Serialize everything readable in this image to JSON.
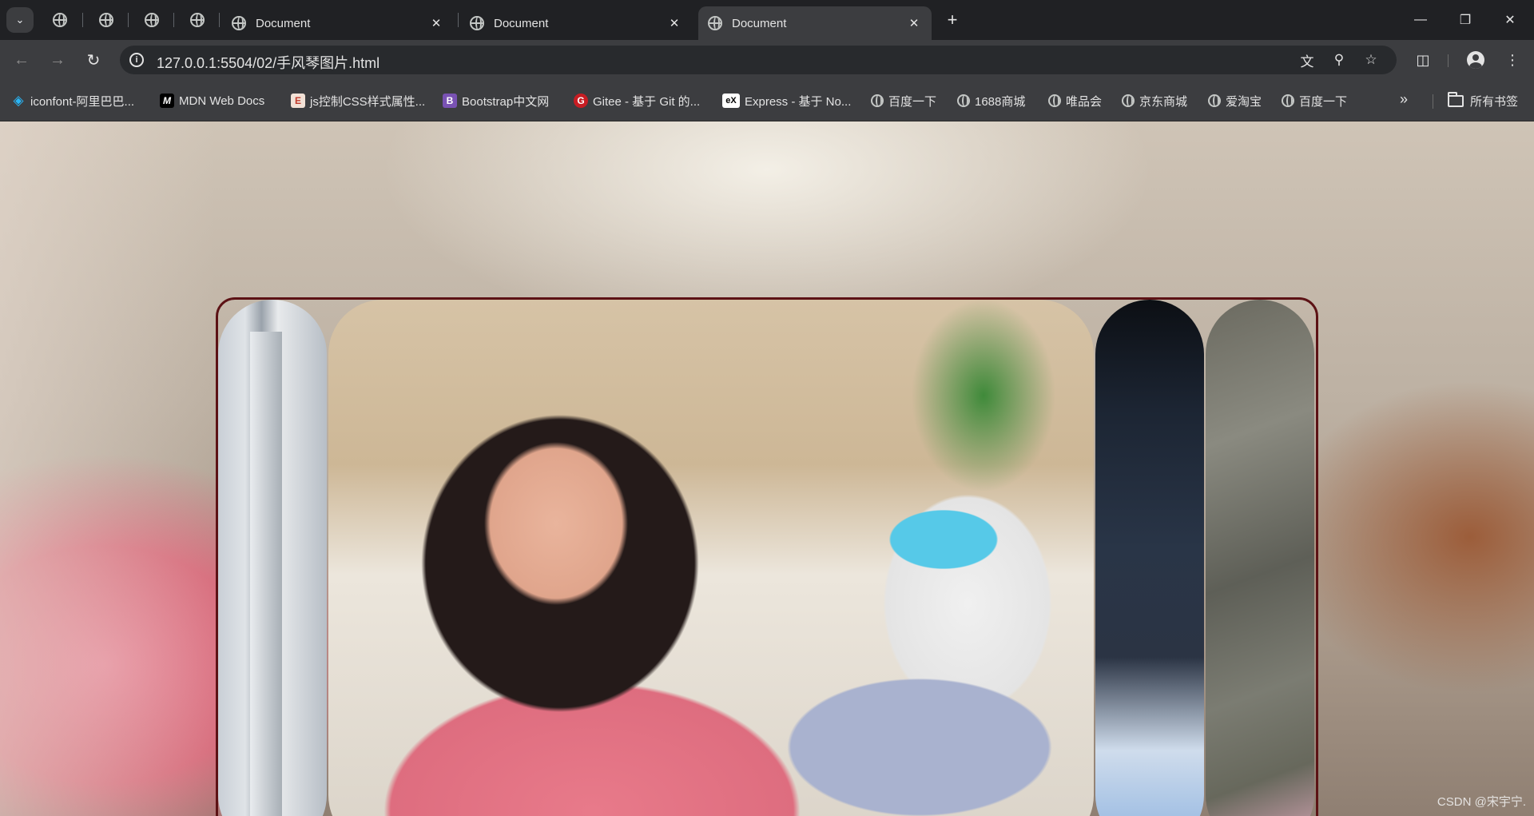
{
  "tabs": [
    {
      "title": "Document",
      "active": false
    },
    {
      "title": "Document",
      "active": false
    },
    {
      "title": "Document",
      "active": true
    }
  ],
  "toolbar": {
    "url": "127.0.0.1:5504/02/手风琴图片.html"
  },
  "bookmarks": [
    {
      "label": "iconfont-阿里巴巴...",
      "icon": "iconfont-icon",
      "color": "#29b6f6"
    },
    {
      "label": "MDN Web Docs",
      "icon": "mdn-icon",
      "color": "#000000"
    },
    {
      "label": "js控制CSS样式属性...",
      "icon": "csdn-icon",
      "color": "#c0392b"
    },
    {
      "label": "Bootstrap中文网",
      "icon": "bootstrap-icon",
      "color": "#7952b3"
    },
    {
      "label": "Gitee - 基于 Git 的...",
      "icon": "gitee-icon",
      "color": "#c71d23"
    },
    {
      "label": "Express - 基于 No...",
      "icon": "express-icon",
      "color": "#ffffff"
    },
    {
      "label": "百度一下",
      "icon": "globe-icon"
    },
    {
      "label": "1688商城",
      "icon": "globe-icon"
    },
    {
      "label": "唯品会",
      "icon": "globe-icon"
    },
    {
      "label": "京东商城",
      "icon": "globe-icon"
    },
    {
      "label": "爱淘宝",
      "icon": "globe-icon"
    },
    {
      "label": "百度一下",
      "icon": "globe-icon"
    }
  ],
  "all_bookmarks_label": "所有书签",
  "page": {
    "gallery": {
      "border_color": "#5c1215",
      "expanded_index": 1,
      "photos": [
        {
          "name": "photo-1-stairs"
        },
        {
          "name": "photo-2-girl-salute"
        },
        {
          "name": "photo-3-dark"
        },
        {
          "name": "photo-4-grass"
        }
      ]
    },
    "watermark": "CSDN @宋宇宁."
  }
}
